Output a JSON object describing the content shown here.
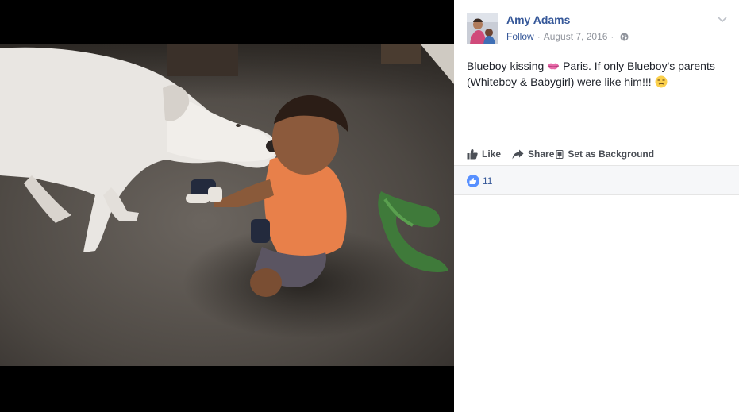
{
  "post": {
    "author": "Amy Adams",
    "follow_label": "Follow",
    "separator": "·",
    "date": "August 7, 2016",
    "privacy_icon": "globe-icon",
    "options_icon": "chevron-down-icon",
    "caption_part1": "Blueboy kissing",
    "caption_emoji1": "kiss-lips-emoji",
    "caption_part2": "Paris. If only Blueboy's parents (Whiteboy & Babygirl) were like him!!!",
    "caption_emoji2": "unamused-face-emoji"
  },
  "actions": {
    "like": "Like",
    "share": "Share",
    "set_background": "Set as Background"
  },
  "reactions": {
    "like_count": "11",
    "icon": "thumbs-up-icon"
  },
  "colors": {
    "link": "#365899",
    "meta": "#90949c",
    "text": "#1d2129",
    "action": "#4b4f56",
    "like_badge": "#5890ff",
    "stage": "#000000"
  }
}
